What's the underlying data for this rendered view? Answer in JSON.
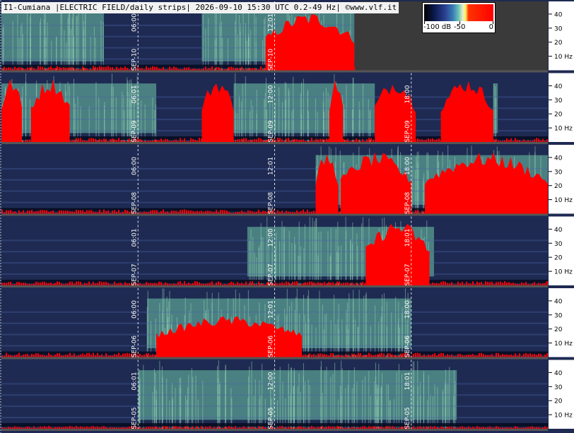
{
  "header": {
    "title": "I1-Cumiana |ELECTRIC FIELD/daily strips| 2026-09-10 15:30 UTC 0.2-49 Hz| ©www.vlf.it"
  },
  "colorbar": {
    "min_label": "-100 dB",
    "mid_label": "-50",
    "max_label": "0",
    "colors": [
      "#000000",
      "#0b1a4f",
      "#2b3f8f",
      "#3a7fb5",
      "#6fc7b8",
      "#e8f0c8",
      "#ffef60",
      "#ff0000"
    ]
  },
  "chart_data": {
    "type": "heatmap",
    "title": "I1-Cumiana |ELECTRIC FIELD/daily strips| 2026-09-10 15:30 UTC 0.2-49 Hz| ©www.vlf.it",
    "ylabel": "",
    "ylim": [
      0,
      49
    ],
    "ytick_labels": [
      "10 Hz",
      "20",
      "30",
      "40"
    ],
    "ytick_values": [
      10,
      20,
      30,
      40
    ],
    "xlim_hours": [
      0,
      24
    ],
    "colors": {
      "background": "#1e2a52",
      "gap": "#3a3a3a",
      "saturated": "#ff0000",
      "green": "#6fc7a8",
      "grid": "#ffffff"
    },
    "strips": [
      {
        "day": "SEP-10",
        "markers": [
          {
            "hour": 6,
            "time": "06:00"
          },
          {
            "hour": 12,
            "time": "12:01"
          }
        ],
        "data_end_hour": 15.5,
        "red_regions": [
          [
            11.6,
            15.5
          ]
        ],
        "red_level": 0.85,
        "green_regions": [
          [
            0,
            4.5
          ],
          [
            8.8,
            15.5
          ]
        ]
      },
      {
        "day": "SEP-09",
        "markers": [
          {
            "hour": 6,
            "time": "06:01"
          },
          {
            "hour": 12,
            "time": "12:00"
          },
          {
            "hour": 18,
            "time": "18:00"
          }
        ],
        "data_end_hour": 24,
        "red_regions": [
          [
            0,
            0.9
          ],
          [
            1.3,
            3.0
          ],
          [
            8.8,
            10.2
          ],
          [
            14.4,
            15.0
          ],
          [
            16.4,
            18.2
          ],
          [
            19.3,
            21.6
          ]
        ],
        "red_level": 0.95,
        "green_regions": [
          [
            0,
            6.8
          ],
          [
            10.2,
            16.4
          ],
          [
            21.6,
            21.8
          ]
        ]
      },
      {
        "day": "SEP-08",
        "markers": [
          {
            "hour": 6,
            "time": "06:00"
          },
          {
            "hour": 12,
            "time": "12:01"
          },
          {
            "hour": 18,
            "time": "18:00"
          }
        ],
        "data_end_hour": 24,
        "red_regions": [
          [
            13.8,
            14.8
          ],
          [
            14.9,
            18.0
          ],
          [
            18.6,
            24
          ]
        ],
        "red_level": 0.9,
        "green_regions": [
          [
            13.8,
            24
          ]
        ]
      },
      {
        "day": "SEP-07",
        "markers": [
          {
            "hour": 6,
            "time": "06:01"
          },
          {
            "hour": 12,
            "time": "12:00"
          },
          {
            "hour": 18,
            "time": "18:01"
          }
        ],
        "data_end_hour": 24,
        "red_regions": [
          [
            16.0,
            18.8
          ]
        ],
        "red_level": 0.95,
        "green_regions": [
          [
            10.8,
            19.0
          ]
        ]
      },
      {
        "day": "SEP-06",
        "markers": [
          {
            "hour": 6,
            "time": "06:00"
          },
          {
            "hour": 12,
            "time": "12:01"
          },
          {
            "hour": 18,
            "time": "18:00"
          }
        ],
        "data_end_hour": 24,
        "red_regions": [
          [
            6.8,
            13.2
          ]
        ],
        "red_level": 0.6,
        "green_regions": [
          [
            6.4,
            18.0
          ]
        ]
      },
      {
        "day": "SEP-05",
        "markers": [
          {
            "hour": 6,
            "time": "06:01"
          },
          {
            "hour": 12,
            "time": "12:00"
          },
          {
            "hour": 18,
            "time": "18:01"
          }
        ],
        "data_end_hour": 24,
        "red_regions": [],
        "red_level": 0.1,
        "green_regions": [
          [
            6.0,
            20.0
          ]
        ]
      }
    ]
  }
}
